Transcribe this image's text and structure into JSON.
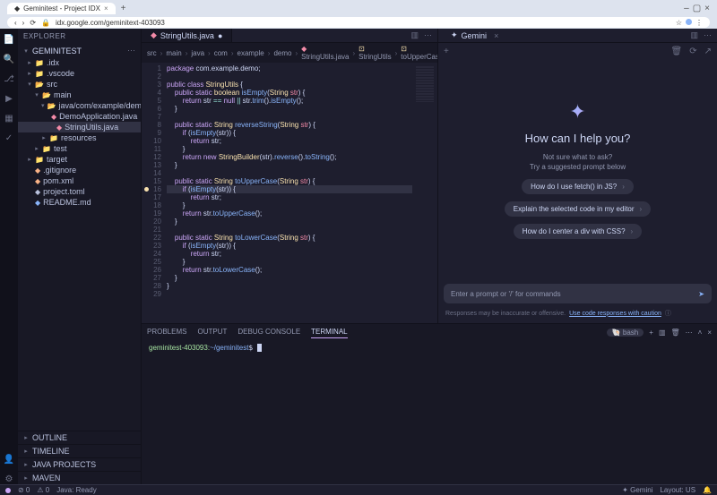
{
  "chrome": {
    "tab_title": "Geminitest - Project IDX",
    "url": "idx.google.com/geminitext-403093"
  },
  "explorer": {
    "title": "EXPLORER",
    "project": "GEMINITEST",
    "tree": [
      {
        "icon": "▸",
        "label": ".idx",
        "pad": 0,
        "color": "c-blue",
        "fico": "📁"
      },
      {
        "icon": "▸",
        "label": ".vscode",
        "pad": 0,
        "color": "",
        "fico": "📁"
      },
      {
        "icon": "▾",
        "label": "src",
        "pad": 0,
        "color": "c-orange",
        "fico": "📂"
      },
      {
        "icon": "▾",
        "label": "main",
        "pad": 1,
        "color": "",
        "fico": "📂"
      },
      {
        "icon": "▾",
        "label": "java/com/example/demo",
        "pad": 2,
        "color": "",
        "fico": "📂"
      },
      {
        "icon": "",
        "label": "DemoApplication.java",
        "pad": 3,
        "color": "c-red",
        "fico": "◆",
        "sel": false
      },
      {
        "icon": "",
        "label": "StringUtils.java",
        "pad": 3,
        "color": "c-red",
        "fico": "◆",
        "sel": true
      },
      {
        "icon": "▸",
        "label": "resources",
        "pad": 2,
        "color": "",
        "fico": "📁"
      },
      {
        "icon": "▸",
        "label": "test",
        "pad": 1,
        "color": "c-green",
        "fico": "📁"
      },
      {
        "icon": "▸",
        "label": "target",
        "pad": 0,
        "color": "c-orange",
        "fico": "📁"
      },
      {
        "icon": "",
        "label": ".gitignore",
        "pad": 0,
        "color": "c-orange",
        "fico": "◆"
      },
      {
        "icon": "",
        "label": "pom.xml",
        "pad": 0,
        "color": "c-orange",
        "fico": "◆"
      },
      {
        "icon": "",
        "label": "project.toml",
        "pad": 0,
        "color": "",
        "fico": "◆"
      },
      {
        "icon": "",
        "label": "README.md",
        "pad": 0,
        "color": "c-blue",
        "fico": "◆"
      }
    ],
    "sections": [
      "OUTLINE",
      "TIMELINE",
      "JAVA PROJECTS",
      "MAVEN"
    ]
  },
  "editor": {
    "tab_icon": "◆",
    "tab_label": "StringUtils.java",
    "crumbs": [
      "src",
      "main",
      "java",
      "com",
      "example",
      "demo",
      "StringUtils.java",
      "StringUtils",
      "toUpperCase(String)"
    ],
    "lines": 29,
    "breakpoint_line": 16,
    "highlight_line": 16
  },
  "code_lines": [
    "<span class='kw'>package</span> com.example.demo;",
    "",
    "<span class='kw'>public class</span> <span class='type'>StringUtils</span> {",
    "    <span class='kw'>public static</span> <span class='type'>boolean</span> <span class='fn'>isEmpty</span>(<span class='type'>String</span> <span class='id'>str</span>) {",
    "        <span class='kw'>return</span> str <span class='op'>==</span> <span class='kw'>null</span> <span class='op'>||</span> str.<span class='fn'>trim</span>().<span class='fn'>isEmpty</span>();",
    "    }",
    "",
    "    <span class='kw'>public static</span> <span class='type'>String</span> <span class='fn'>reverseString</span>(<span class='type'>String</span> <span class='id'>str</span>) {",
    "        <span class='kw'>if</span> (<span class='fn'>isEmpty</span>(str)) {",
    "            <span class='kw'>return</span> str;",
    "        }",
    "        <span class='kw'>return new</span> <span class='type'>StringBuilder</span>(str).<span class='fn'>reverse</span>().<span class='fn'>toString</span>();",
    "    }",
    "",
    "    <span class='kw'>public static</span> <span class='type'>String</span> <span class='fn'>toUpperCase</span>(<span class='type'>String</span> <span class='id'>str</span>) {",
    "        <span class='kw'>if</span> (<span class='fn'>isEmpty</span>(str)) {",
    "            <span class='kw'>return</span> str;",
    "        }",
    "        <span class='kw'>return</span> str.<span class='fn'>toUpperCase</span>();",
    "    }",
    "",
    "    <span class='kw'>public static</span> <span class='type'>String</span> <span class='fn'>toLowerCase</span>(<span class='type'>String</span> <span class='id'>str</span>) {",
    "        <span class='kw'>if</span> (<span class='fn'>isEmpty</span>(str)) {",
    "            <span class='kw'>return</span> str;",
    "        }",
    "        <span class='kw'>return</span> str.<span class='fn'>toLowerCase</span>();",
    "    }",
    "}",
    ""
  ],
  "panel": {
    "tabs": [
      "PROBLEMS",
      "OUTPUT",
      "DEBUG CONSOLE",
      "TERMINAL"
    ],
    "active": 3,
    "shell_pill": "bash",
    "prompt_user": "geminitest-403093",
    "prompt_path": "~/geminitest"
  },
  "gemini": {
    "tab": "Gemini",
    "heading": "How can I help you?",
    "sub1": "Not sure what to ask?",
    "sub2": "Try a suggested prompt below",
    "chips": [
      "How do I use fetch() in JS?",
      "Explain the selected code in my editor",
      "How do I center a div with CSS?"
    ],
    "input_placeholder": "Enter a prompt or '/' for commands",
    "footer_text": "Responses may be inaccurate or offensive.",
    "footer_link": "Use code responses with caution"
  },
  "status": {
    "java": "Java: Ready",
    "gemini": "Gemini",
    "layout": "Layout: US"
  }
}
